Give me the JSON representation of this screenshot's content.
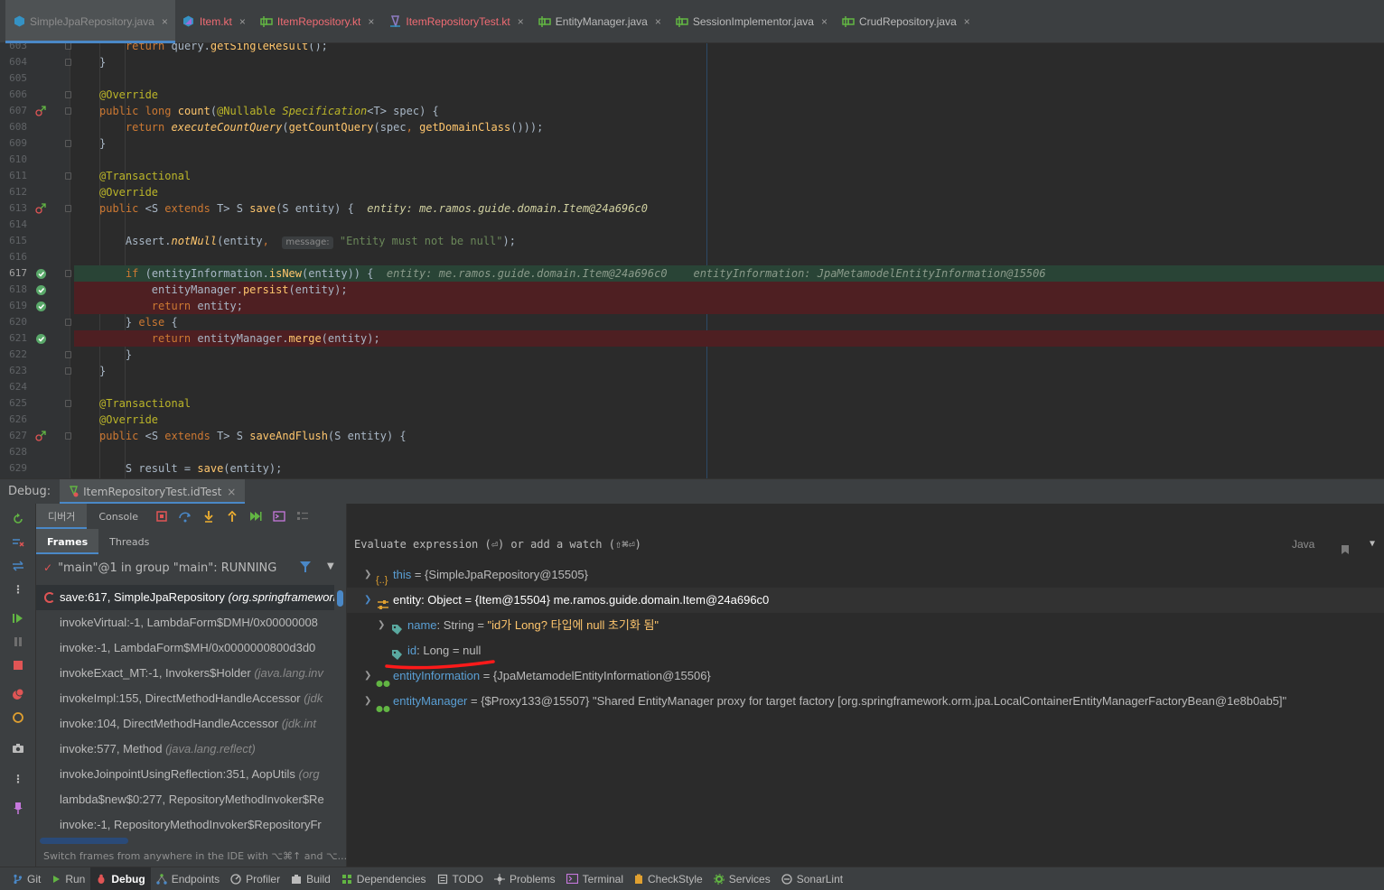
{
  "tabs": [
    {
      "label": "SimpleJpaRepository.java",
      "icon": "class-icon",
      "active": true,
      "red": false
    },
    {
      "label": "Item.kt",
      "icon": "kotlin-class-icon",
      "active": false,
      "red": true
    },
    {
      "label": "ItemRepository.kt",
      "icon": "interface-icon",
      "active": false,
      "red": true
    },
    {
      "label": "ItemRepositoryTest.kt",
      "icon": "test-class-icon",
      "active": false,
      "red": true
    },
    {
      "label": "EntityManager.java",
      "icon": "interface-icon",
      "active": false,
      "red": false
    },
    {
      "label": "SessionImplementor.java",
      "icon": "interface-icon",
      "active": false,
      "red": false
    },
    {
      "label": "CrudRepository.java",
      "icon": "interface-icon",
      "active": false,
      "red": false
    }
  ],
  "code_lines": [
    {
      "n": "603",
      "html": "    <span class='kw'>return</span> <span class='plain'>query.</span><span class='meth'>getSingleResult</span><span class='plain'>();</span>"
    },
    {
      "n": "604",
      "html": "<span class='plain'>}</span>"
    },
    {
      "n": "605",
      "html": ""
    },
    {
      "n": "606",
      "html": "<span class='ann'>@Override</span>"
    },
    {
      "n": "607",
      "html": "<span class='kw'>public long</span> <span class='meth'>count</span><span class='plain'>(</span><span class='ann'>@Nullable</span> <span class='type-it' style='color:#bbb529'>Specification</span><span class='plain'>&lt;T&gt; spec) {</span>"
    },
    {
      "n": "608",
      "html": "    <span class='kw'>return</span> <span class='meth ital'>executeCountQuery</span><span class='plain'>(</span><span class='meth'>getCountQuery</span><span class='plain'>(spec</span><span class='kw'>,</span> <span class='meth'>getDomainClass</span><span class='plain'>()));</span>"
    },
    {
      "n": "609",
      "html": "<span class='plain'>}</span>"
    },
    {
      "n": "610",
      "html": ""
    },
    {
      "n": "611",
      "html": "<span class='ann'>@Transactional</span>"
    },
    {
      "n": "612",
      "html": "<span class='ann'>@Override</span>"
    },
    {
      "n": "613",
      "html": "<span class='kw'>public</span> <span class='plain'>&lt;S </span><span class='kw'>extends</span><span class='plain'> T&gt; S </span><span class='meth'>save</span><span class='plain'>(S entity) {  </span><span class='inline-val' style='color:#d0d0a0'>entity: me.ramos.guide.domain.Item@24a696c0</span>"
    },
    {
      "n": "614",
      "html": ""
    },
    {
      "n": "615",
      "html": "    <span class='plain'>Assert.</span><span class='meth ital'>notNull</span><span class='plain'>(entity</span><span class='kw'>,</span>  <span class='hint'>message:</span> <span class='str'>\"Entity must not be null\"</span><span class='plain'>);</span>"
    },
    {
      "n": "616",
      "html": ""
    },
    {
      "n": "617",
      "html": "    <span class='kw'>if</span> <span class='plain'>(entityInformation.</span><span class='meth'>isNew</span><span class='plain'>(entity)) {  </span><span class='inline-val' style='color:#8a9a8a'>entity: me.ramos.guide.domain.Item@24a696c0    entityInformation: JpaMetamodelEntityInformation@15506</span>"
    },
    {
      "n": "618",
      "html": "        <span class='plain'>entityManager.</span><span class='meth'>persist</span><span class='plain'>(entity);</span>"
    },
    {
      "n": "619",
      "html": "        <span class='kw'>return</span> <span class='plain'>entity;</span>"
    },
    {
      "n": "620",
      "html": "    <span class='plain'>} </span><span class='kw'>else</span><span class='plain'> {</span>"
    },
    {
      "n": "621",
      "html": "        <span class='kw'>return</span> <span class='plain'>entityManager.</span><span class='meth'>merge</span><span class='plain'>(entity);</span>"
    },
    {
      "n": "622",
      "html": "    <span class='plain'>}</span>"
    },
    {
      "n": "623",
      "html": "<span class='plain'>}</span>"
    },
    {
      "n": "624",
      "html": ""
    },
    {
      "n": "625",
      "html": "<span class='ann'>@Transactional</span>"
    },
    {
      "n": "626",
      "html": "<span class='ann'>@Override</span>"
    },
    {
      "n": "627",
      "html": "<span class='kw'>public</span> <span class='plain'>&lt;S </span><span class='kw'>extends</span><span class='plain'> T&gt; S </span><span class='meth'>saveAndFlush</span><span class='plain'>(S entity) {</span>"
    },
    {
      "n": "628",
      "html": ""
    },
    {
      "n": "629",
      "html": "    <span class='plain'>S result = </span><span class='meth'>save</span><span class='plain'>(entity);</span>"
    }
  ],
  "debug": {
    "label": "Debug:",
    "session_tab": "ItemRepositoryTest.idTest",
    "subtab_debugger": "디버거",
    "subtab_console": "Console",
    "frames_tab": "Frames",
    "threads_tab": "Threads",
    "thread": "\"main\"@1 in group \"main\": RUNNING",
    "frames": [
      {
        "text": "save:617, SimpleJpaRepository ",
        "pkg": "(org.springframework",
        "sel": true
      },
      {
        "text": "invokeVirtual:-1, LambdaForm$DMH/0x00000008",
        "pkg": "",
        "sel": false
      },
      {
        "text": "invoke:-1, LambdaForm$MH/0x0000000800d3d0",
        "pkg": "",
        "sel": false
      },
      {
        "text": "invokeExact_MT:-1, Invokers$Holder ",
        "pkg": "(java.lang.inv",
        "sel": false
      },
      {
        "text": "invokeImpl:155, DirectMethodHandleAccessor ",
        "pkg": "(jdk",
        "sel": false
      },
      {
        "text": "invoke:104, DirectMethodHandleAccessor ",
        "pkg": "(jdk.int",
        "sel": false
      },
      {
        "text": "invoke:577, Method ",
        "pkg": "(java.lang.reflect)",
        "sel": false
      },
      {
        "text": "invokeJoinpointUsingReflection:351, AopUtils ",
        "pkg": "(org",
        "sel": false
      },
      {
        "text": "lambda$new$0:277, RepositoryMethodInvoker$Re",
        "pkg": "",
        "sel": false
      },
      {
        "text": "invoke:-1, RepositoryMethodInvoker$RepositoryFr",
        "pkg": "",
        "sel": false
      }
    ],
    "switch_hint": "Switch frames from anywhere in the IDE with ⌥⌘↑ and ⌥...",
    "switch_close": "×"
  },
  "vars": {
    "eval_placeholder": "Evaluate expression (⏎) or add a watch (⇧⌘⏎)",
    "lang": "Java",
    "rows": [
      {
        "name": "this",
        "rest": " = {SimpleJpaRepository@15505}"
      },
      {
        "name": "entity: Object",
        "rest": "  = {Item@15504} me.ramos.guide.domain.Item@24a696c0"
      },
      {
        "name": "name",
        "type": ": String",
        "eq": "  = ",
        "val": "\"id가 Long? 타입에 null 초기화 됨\""
      },
      {
        "name": "id",
        "type": ": Long",
        "eq": "  = ",
        "val": "null"
      },
      {
        "name": "entityInformation",
        "rest": " = {JpaMetamodelEntityInformation@15506}"
      },
      {
        "name": "entityManager",
        "rest": " = {$Proxy133@15507} \"Shared EntityManager proxy for target factory [org.springframework.orm.jpa.LocalContainerEntityManagerFactoryBean@1e8b0ab5]\""
      }
    ]
  },
  "status": [
    {
      "label": "Git",
      "icon": "git-icon"
    },
    {
      "label": "Run",
      "icon": "run-icon"
    },
    {
      "label": "Debug",
      "icon": "debug-icon",
      "active": true
    },
    {
      "label": "Endpoints",
      "icon": "endpoints-icon"
    },
    {
      "label": "Profiler",
      "icon": "profiler-icon"
    },
    {
      "label": "Build",
      "icon": "build-icon"
    },
    {
      "label": "Dependencies",
      "icon": "dependencies-icon"
    },
    {
      "label": "TODO",
      "icon": "todo-icon"
    },
    {
      "label": "Problems",
      "icon": "problems-icon"
    },
    {
      "label": "Terminal",
      "icon": "terminal-icon"
    },
    {
      "label": "CheckStyle",
      "icon": "checkstyle-icon"
    },
    {
      "label": "Services",
      "icon": "services-icon"
    },
    {
      "label": "SonarLint",
      "icon": "sonarlint-icon"
    }
  ]
}
